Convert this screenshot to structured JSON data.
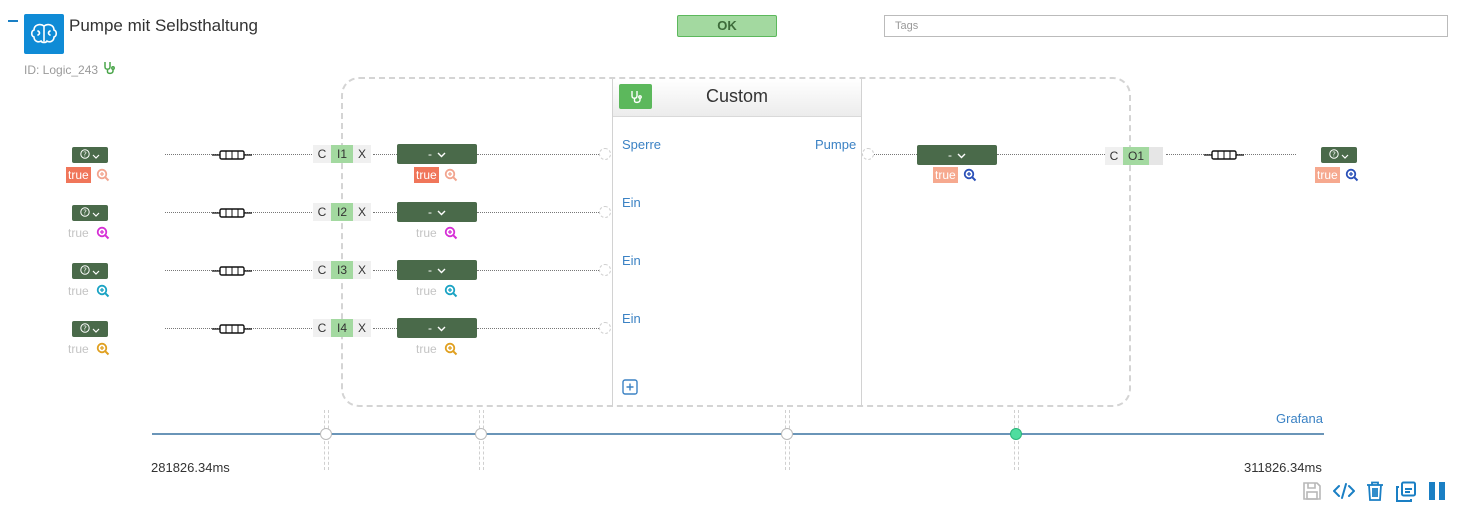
{
  "header": {
    "title": "Pumpe mit Selbsthaltung",
    "id_label": "ID: Logic_243",
    "status": "OK",
    "tags_placeholder": "Tags"
  },
  "block": {
    "title": "Custom",
    "inputs": [
      "Sperre",
      "Ein",
      "Ein",
      "Ein"
    ],
    "outputs": [
      "Pumpe"
    ]
  },
  "source_rows": [
    {
      "value": "true",
      "state": "active",
      "zoom_color": "#f2a58f"
    },
    {
      "value": "true",
      "state": "inactive",
      "zoom_color": "#d62fd6"
    },
    {
      "value": "true",
      "state": "inactive",
      "zoom_color": "#1aa3c4"
    },
    {
      "value": "true",
      "state": "inactive",
      "zoom_color": "#e0a020"
    }
  ],
  "input_pins": [
    {
      "c": "C",
      "name": "I1",
      "x": "X",
      "select": "-",
      "value": "true",
      "state": "active",
      "zoom_color": "#f2a58f"
    },
    {
      "c": "C",
      "name": "I2",
      "x": "X",
      "select": "-",
      "value": "true",
      "state": "inactive",
      "zoom_color": "#d62fd6"
    },
    {
      "c": "C",
      "name": "I3",
      "x": "X",
      "select": "-",
      "value": "true",
      "state": "inactive",
      "zoom_color": "#1aa3c4"
    },
    {
      "c": "C",
      "name": "I4",
      "x": "X",
      "select": "-",
      "value": "true",
      "state": "inactive",
      "zoom_color": "#e0a020"
    }
  ],
  "output_select": {
    "select": "-",
    "value": "true",
    "zoom_color": "#2a50b8"
  },
  "output_pin": {
    "c": "C",
    "name": "O1"
  },
  "sink": {
    "value": "true",
    "zoom_color": "#2a50b8"
  },
  "timeline": {
    "start": "281826.34ms",
    "end": "311826.34ms",
    "link": "Grafana",
    "accent": "#4fdd9f"
  },
  "colors": {
    "brand": "#0f8bd6",
    "node": "#4a6a4a",
    "ok": "#a3d9a0"
  },
  "icons": [
    "brain-icon",
    "stethoscope-icon",
    "help-icon",
    "chevron-down-icon",
    "zoom-icon",
    "fuse-icon",
    "plus-box-icon",
    "save-icon",
    "code-icon",
    "trash-icon",
    "copy-icon",
    "pause-icon"
  ]
}
